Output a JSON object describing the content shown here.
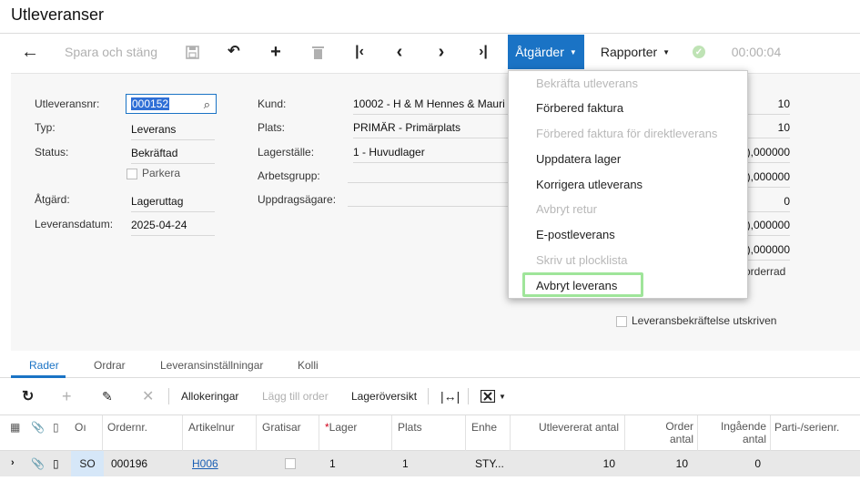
{
  "page": {
    "title": "Utleveranser"
  },
  "toolbar": {
    "back_icon": "arrow-left-icon",
    "save_close": "Spara och stäng",
    "save_icon": "floppy-disk-icon",
    "undo_icon": "undo-icon",
    "add_icon": "plus-icon",
    "delete_icon": "trash-icon",
    "first_icon": "first-record-icon",
    "prev_icon": "chevron-left-icon",
    "next_icon": "chevron-right-icon",
    "last_icon": "last-record-icon",
    "actions": "Åtgärder",
    "reports": "Rapporter",
    "status_icon": "check-circle-icon",
    "timer": "00:00:04"
  },
  "form": {
    "shipment_nr_label": "Utleveransnr:",
    "shipment_nr_value": "000152",
    "type_label": "Typ:",
    "type_value": "Leverans",
    "status_label": "Status:",
    "status_value": "Bekräftad",
    "park_label": "Parkera",
    "action_label": "Åtgärd:",
    "action_value": "Lageruttag",
    "date_label": "Leveransdatum:",
    "date_value": "2025-04-24",
    "customer_label": "Kund:",
    "customer_value": "10002 - H & M Hennes & Mauri",
    "location_label": "Plats:",
    "location_value": "PRIMÄR - Primärplats",
    "warehouse_label": "Lagerställe:",
    "warehouse_value": "1 - Huvudlager",
    "workgroup_label": "Arbetsgrupp:",
    "owner_label": "Uppdragsägare:",
    "right_values": [
      "10",
      "10",
      "),000000",
      "),000000",
      "0",
      "),000000",
      "),000000",
      "orderrad"
    ],
    "confirm_printed_label": "Leveransbekräftelse utskriven"
  },
  "actions_menu": {
    "items": [
      {
        "label": "Bekräfta utleverans",
        "enabled": false
      },
      {
        "label": "Förbered faktura",
        "enabled": true
      },
      {
        "label": "Förbered faktura för direktleverans",
        "enabled": false
      },
      {
        "label": "Uppdatera lager",
        "enabled": true
      },
      {
        "label": "Korrigera utleverans",
        "enabled": true
      },
      {
        "label": "Avbryt retur",
        "enabled": false
      },
      {
        "label": "E-postleverans",
        "enabled": true
      },
      {
        "label": "Skriv ut plocklista",
        "enabled": false
      },
      {
        "label": "Avbryt leverans",
        "enabled": true
      }
    ],
    "highlight_color": "#9fe59a"
  },
  "tabs": [
    "Rader",
    "Ordrar",
    "Leveransinställningar",
    "Kolli"
  ],
  "grid_toolbar": {
    "refresh_icon": "refresh-icon",
    "add_icon": "plus-icon",
    "edit_icon": "pencil-icon",
    "delete_icon": "close-icon",
    "allocations": "Allokeringar",
    "add_order": "Lägg till order",
    "stock_overview": "Lageröversikt",
    "fit_icon": "fit-columns-icon",
    "excel_icon": "excel-export-icon"
  },
  "grid": {
    "headers": {
      "type": "Oı",
      "order_nr": "Ordernr.",
      "item_nr": "Artikelnur",
      "free": "Gratisar",
      "warehouse": "Lager",
      "location": "Plats",
      "unit": "Enhe",
      "shipped_qty": "Utlevererat antal",
      "order_qty_1": "Order",
      "order_qty_2": "antal",
      "open_qty_1": "Ingående",
      "open_qty_2": "antal",
      "lot_serial": "Parti-/serienr."
    },
    "row": {
      "type": "SO",
      "order_nr": "000196",
      "item_nr": "H006",
      "warehouse": "1",
      "location": "1",
      "unit": "STY...",
      "shipped_qty": "10",
      "order_qty": "10",
      "open_qty": "0"
    }
  },
  "colors": {
    "accent": "#1a73c5",
    "selected_row": "#e8e8e8"
  }
}
